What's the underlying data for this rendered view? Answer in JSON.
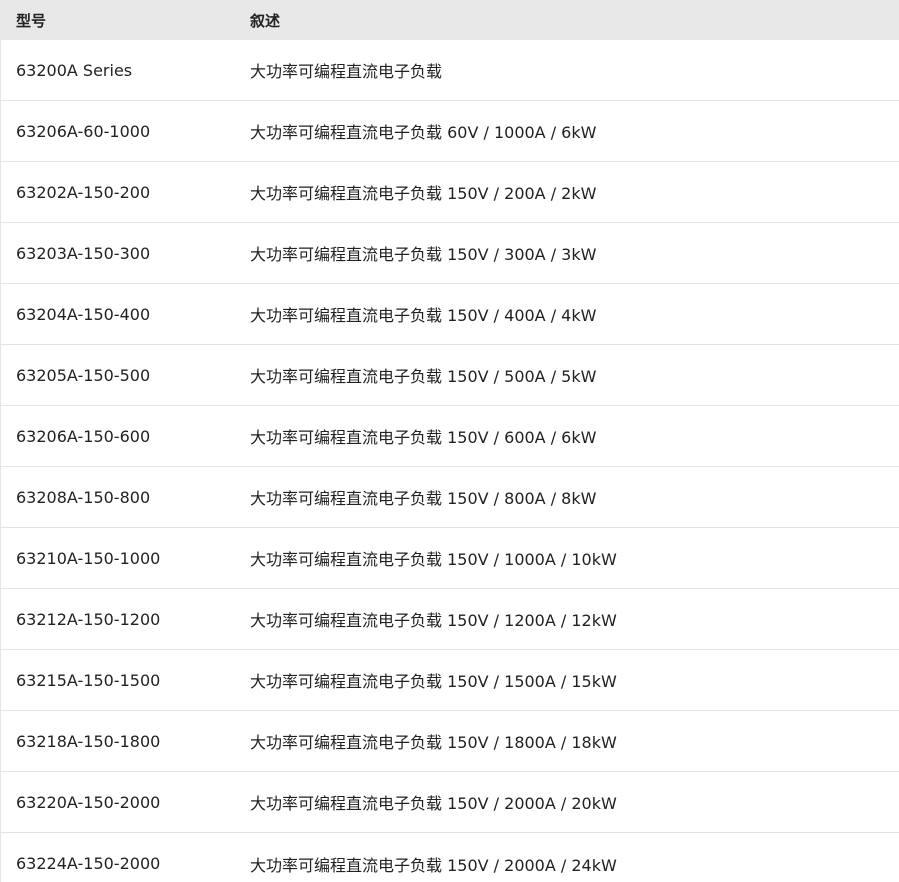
{
  "headers": {
    "model": "型号",
    "description": "叙述"
  },
  "rows": [
    {
      "model": "63200A Series",
      "description": "大功率可编程直流电子负载"
    },
    {
      "model": "63206A-60-1000",
      "description": "大功率可编程直流电子负载 60V / 1000A / 6kW"
    },
    {
      "model": "63202A-150-200",
      "description": "大功率可编程直流电子负载 150V / 200A / 2kW"
    },
    {
      "model": "63203A-150-300",
      "description": "大功率可编程直流电子负载 150V / 300A / 3kW"
    },
    {
      "model": "63204A-150-400",
      "description": "大功率可编程直流电子负载 150V / 400A / 4kW"
    },
    {
      "model": "63205A-150-500",
      "description": "大功率可编程直流电子负载 150V / 500A / 5kW"
    },
    {
      "model": "63206A-150-600",
      "description": "大功率可编程直流电子负载 150V / 600A / 6kW"
    },
    {
      "model": "63208A-150-800",
      "description": "大功率可编程直流电子负载 150V / 800A / 8kW"
    },
    {
      "model": "63210A-150-1000",
      "description": "大功率可编程直流电子负载 150V / 1000A / 10kW"
    },
    {
      "model": "63212A-150-1200",
      "description": "大功率可编程直流电子负载 150V / 1200A / 12kW"
    },
    {
      "model": "63215A-150-1500",
      "description": "大功率可编程直流电子负载 150V / 1500A / 15kW"
    },
    {
      "model": "63218A-150-1800",
      "description": "大功率可编程直流电子负载 150V / 1800A / 18kW"
    },
    {
      "model": "63220A-150-2000",
      "description": "大功率可编程直流电子负载 150V / 2000A / 20kW"
    },
    {
      "model": "63224A-150-2000",
      "description": "大功率可编程直流电子负载 150V / 2000A / 24kW"
    }
  ]
}
